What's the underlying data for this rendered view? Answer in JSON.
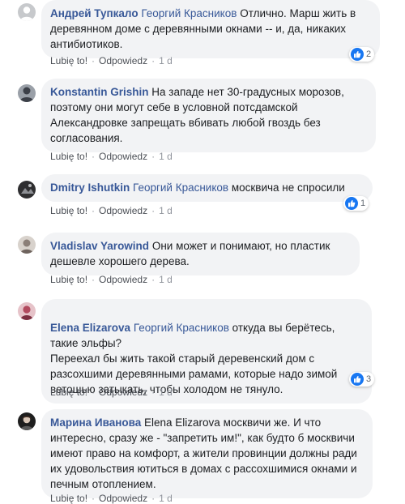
{
  "comments": [
    {
      "author": "Андрей Тупкало",
      "mention": "Георгий Красников",
      "text": "Отлично. Марш жить в деревянном доме с деревянными окнами -- и, да, никаких антибиотиков.",
      "like_label": "Lubię to!",
      "reply_label": "Odpowiedz",
      "time": "1 d",
      "reactions": "2",
      "avatar_color": "#c7c9cc"
    },
    {
      "author": "Konstantin Grishin",
      "text": "На западе нет 30-градусных морозов, поэтому они могут себе в условной потсдамской Александровке запрещать вбивать любой гвоздь без согласования.",
      "like_label": "Lubię to!",
      "reply_label": "Odpowiedz",
      "time": "1 d",
      "avatar_color": "#3c4048"
    },
    {
      "author": "Dmitry Ishutkin",
      "mention": "Георгий Красников",
      "text": "москвича не спросили",
      "like_label": "Lubię to!",
      "reply_label": "Odpowiedz",
      "time": "1 d",
      "reactions": "1",
      "avatar_color": "#2e2e30"
    },
    {
      "author": "Vladislav Yarowind",
      "text": "Они может и понимают, но пластик дешевле хорошего дерева.",
      "like_label": "Lubię to!",
      "reply_label": "Odpowiedz",
      "time": "1 d",
      "avatar_color": "#8b7f78"
    },
    {
      "author": "Elena Elizarova",
      "mention": "Георгий Красников",
      "text": "откуда вы берётесь, такие эльфы?\nПереехал бы жить такой старый деревенский дом с разсохшими деревянными рамами, которые надо зимой ветошью затыкать, чтобы холодом не тянуло.",
      "like_label": "Lubię to!",
      "reply_label": "Odpowiedz",
      "time": "1 d",
      "reactions": "3",
      "avatar_color": "#b24a5e"
    },
    {
      "author": "Марина Иванова",
      "text": "Elena Elizarova москвичи же. И что интересно, сразу же - \"запретить им!\", как будто б москвичи имеют право на комфорт, а жители провинции должны ради их удовольствия ютиться в домах с рассохшимися окнами и печным отоплением.",
      "like_label": "Lubię to!",
      "reply_label": "Odpowiedz",
      "time": "1 d",
      "avatar_color": "#1e1e1e"
    }
  ],
  "colors": {
    "link": "#385898",
    "bubble": "#f2f3f5",
    "meta": "#90949c",
    "like_badge": "#1877f2"
  },
  "icons": {
    "reaction": "thumbs-up-icon"
  }
}
